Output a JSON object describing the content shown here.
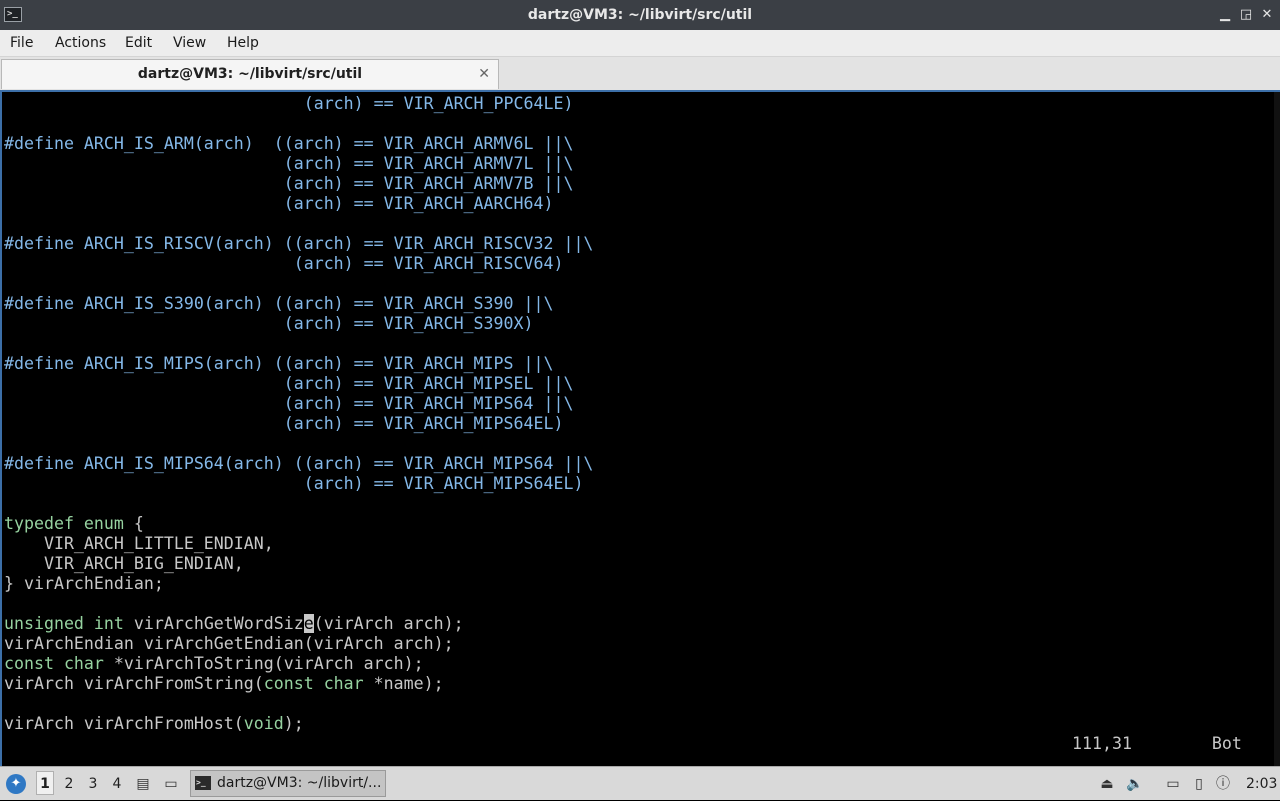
{
  "window": {
    "title": "dartz@VM3: ~/libvirt/src/util",
    "minimize_symbol": "▁",
    "restore_symbol": "◲",
    "close_symbol": "✕"
  },
  "menubar": {
    "file": "File",
    "actions": "Actions",
    "edit": "Edit",
    "view": "View",
    "help": "Help"
  },
  "tab": {
    "label": "dartz@VM3: ~/libvirt/src/util",
    "close_symbol": "✕"
  },
  "terminal": {
    "lines": [
      [
        {
          "t": "                              (arch) == VIR_ARCH_PPC64LE)",
          "c": "pp"
        }
      ],
      [],
      [
        {
          "t": "#define ARCH_IS_ARM(arch)  ((arch) == VIR_ARCH_ARMV6L ||\\",
          "c": "pp"
        }
      ],
      [
        {
          "t": "                            (arch) == VIR_ARCH_ARMV7L ||\\",
          "c": "pp"
        }
      ],
      [
        {
          "t": "                            (arch) == VIR_ARCH_ARMV7B ||\\",
          "c": "pp"
        }
      ],
      [
        {
          "t": "                            (arch) == VIR_ARCH_AARCH64)",
          "c": "pp"
        }
      ],
      [],
      [
        {
          "t": "#define ARCH_IS_RISCV(arch) ((arch) == VIR_ARCH_RISCV32 ||\\",
          "c": "pp"
        }
      ],
      [
        {
          "t": "                             (arch) == VIR_ARCH_RISCV64)",
          "c": "pp"
        }
      ],
      [],
      [
        {
          "t": "#define ARCH_IS_S390(arch) ((arch) == VIR_ARCH_S390 ||\\",
          "c": "pp"
        }
      ],
      [
        {
          "t": "                            (arch) == VIR_ARCH_S390X)",
          "c": "pp"
        }
      ],
      [],
      [
        {
          "t": "#define ARCH_IS_MIPS(arch) ((arch) == VIR_ARCH_MIPS ||\\",
          "c": "pp"
        }
      ],
      [
        {
          "t": "                            (arch) == VIR_ARCH_MIPSEL ||\\",
          "c": "pp"
        }
      ],
      [
        {
          "t": "                            (arch) == VIR_ARCH_MIPS64 ||\\",
          "c": "pp"
        }
      ],
      [
        {
          "t": "                            (arch) == VIR_ARCH_MIPS64EL)",
          "c": "pp"
        }
      ],
      [],
      [
        {
          "t": "#define ARCH_IS_MIPS64(arch) ((arch) == VIR_ARCH_MIPS64 ||\\",
          "c": "pp"
        }
      ],
      [
        {
          "t": "                              (arch) == VIR_ARCH_MIPS64EL)",
          "c": "pp"
        }
      ],
      [],
      [
        {
          "t": "typedef enum",
          "c": "type"
        },
        {
          "t": " {",
          "c": "plain"
        }
      ],
      [
        {
          "t": "    VIR_ARCH_LITTLE_ENDIAN,",
          "c": "plain"
        }
      ],
      [
        {
          "t": "    VIR_ARCH_BIG_ENDIAN,",
          "c": "plain"
        }
      ],
      [
        {
          "t": "} virArchEndian;",
          "c": "plain"
        }
      ],
      [],
      [
        {
          "t": "unsigned int",
          "c": "type"
        },
        {
          "t": " virArchGetWordSiz",
          "c": "plain"
        },
        {
          "t": "e",
          "c": "cursor"
        },
        {
          "t": "(virArch arch);",
          "c": "plain"
        }
      ],
      [
        {
          "t": "virArchEndian virArchGetEndian(virArch arch);",
          "c": "plain"
        }
      ],
      [
        {
          "t": "const char",
          "c": "type"
        },
        {
          "t": " *virArchToString(virArch arch);",
          "c": "plain"
        }
      ],
      [
        {
          "t": "virArch virArchFromString(",
          "c": "plain"
        },
        {
          "t": "const char",
          "c": "type"
        },
        {
          "t": " *name);",
          "c": "plain"
        }
      ],
      [],
      [
        {
          "t": "virArch virArchFromHost(",
          "c": "plain"
        },
        {
          "t": "void",
          "c": "type"
        },
        {
          "t": ");",
          "c": "plain"
        }
      ]
    ],
    "cursor_position": "111,31",
    "scroll_position": "Bot"
  },
  "taskbar": {
    "start_icon": "start-menu-icon",
    "desktops": [
      "1",
      "2",
      "3",
      "4"
    ],
    "active_desktop": "1",
    "task_label": "dartz@VM3: ~/libvirt/...",
    "clock": "2:03"
  },
  "colors": {
    "preprocessor": "#84b8e8",
    "type_keyword": "#96d2a0",
    "plain_text": "#c8c8c8",
    "terminal_bg": "#000000",
    "titlebar_bg": "#3b3f45",
    "taskbar_bg": "#d9d9d9"
  }
}
